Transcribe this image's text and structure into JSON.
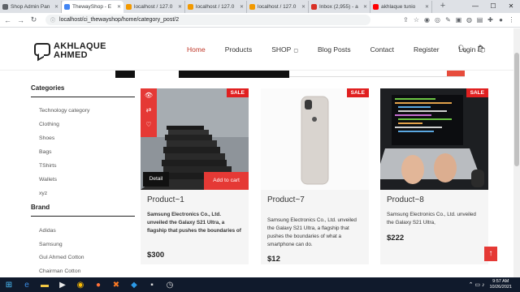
{
  "browser": {
    "tabs": [
      {
        "label": "Shop Admin Pan",
        "color": "#5f6368",
        "active": false
      },
      {
        "label": "ThewayShop - E",
        "color": "#4285f4",
        "active": true
      },
      {
        "label": "localhost / 127.0",
        "color": "#f29900",
        "active": false
      },
      {
        "label": "localhost / 127.0",
        "color": "#f29900",
        "active": false
      },
      {
        "label": "localhost / 127.0",
        "color": "#f29900",
        "active": false
      },
      {
        "label": "Inbox (2,955) - a",
        "color": "#d93025",
        "active": false
      },
      {
        "label": "akhlaque tunio",
        "color": "#ff0000",
        "active": false
      },
      {
        "label": "",
        "color": "#5f6368",
        "active": false
      }
    ],
    "url": "localhost/ci_thewayshop/home/category_post/2"
  },
  "site": {
    "logo_line1": "AKHLAQUE",
    "logo_line2": "AHMED",
    "nav": {
      "home": "Home",
      "products": "Products",
      "shop": "SHOP",
      "blog": "Blog Posts",
      "contact": "Contact",
      "register": "Register",
      "login": "Login"
    }
  },
  "sidebar": {
    "categories_title": "Categories",
    "categories": [
      "Technology category",
      "Clothing",
      "Shoes",
      "Bags",
      "TShirts",
      "Wallets",
      "xyz"
    ],
    "brand_title": "Brand",
    "brands": [
      "Adidas",
      "Samsung",
      "Gul Ahmed Cotton",
      "Chairman Cotton"
    ]
  },
  "products": [
    {
      "name": "Product~1",
      "badge": "SALE",
      "desc": "Samsung Electronics Co., Ltd. unveiled the Galaxy S21 Ultra, a flagship that pushes the boundaries of",
      "price": "$300",
      "detail_label": "Detail",
      "cart_label": "Add to cart"
    },
    {
      "name": "Product~7",
      "badge": "SALE",
      "desc": "Samsung Electronics Co., Ltd. unveiled the Galaxy S21 Ultra, a flagship that pushes the boundaries of what a smartphone can do.",
      "price": "$12"
    },
    {
      "name": "Product~8",
      "badge": "SALE",
      "desc": "Samsung Electronics Co., Ltd. unveiled the Galaxy S21 Ultra,",
      "price": "$222"
    }
  ],
  "taskbar": {
    "time": "9:57 AM",
    "date": "10/26/2021"
  },
  "colors": {
    "accent": "#e53935",
    "nav_active": "#c0392b"
  }
}
